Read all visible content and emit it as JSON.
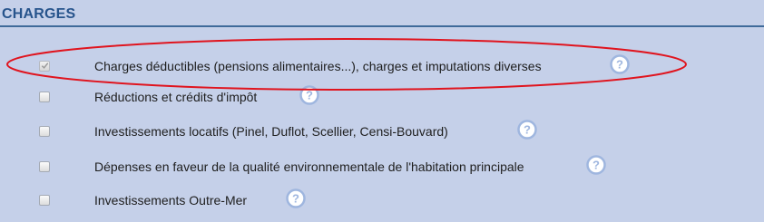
{
  "section": {
    "title": "CHARGES"
  },
  "options": [
    {
      "label": "Charges déductibles (pensions alimentaires...), charges et imputations diverses",
      "checked": true,
      "help_icon": "question-mark-icon"
    },
    {
      "label": "Réductions et crédits d'impôt",
      "checked": false,
      "help_icon": "question-mark-icon"
    },
    {
      "label": "Investissements locatifs (Pinel, Duflot, Scellier, Censi-Bouvard)",
      "checked": false,
      "help_icon": "question-mark-icon"
    },
    {
      "label": "Dépenses en faveur de la qualité environnementale de l'habitation principale",
      "checked": false,
      "help_icon": "question-mark-icon"
    },
    {
      "label": "Investissements Outre-Mer",
      "checked": false,
      "help_icon": "question-mark-icon"
    }
  ],
  "colors": {
    "background": "#c5d0e9",
    "title": "#27548c",
    "annotation_ellipse": "#e0141e",
    "help_icon_ring": "#9fb6df"
  }
}
